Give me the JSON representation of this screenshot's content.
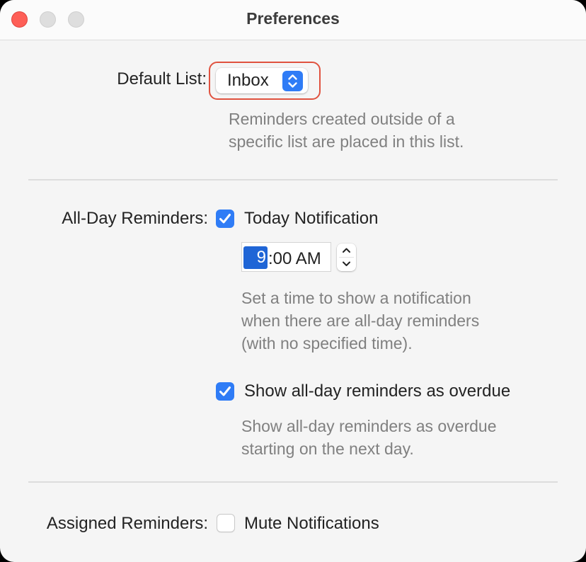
{
  "window": {
    "title": "Preferences",
    "controls": {
      "close": "close-button",
      "minimize": "minimize-button",
      "zoom": "zoom-button"
    }
  },
  "default_list": {
    "label": "Default List:",
    "selected": "Inbox",
    "description_lines": [
      "Reminders created outside of a",
      "specific list are placed in this list."
    ]
  },
  "all_day": {
    "label": "All-Day Reminders:",
    "today_notification": {
      "label": "Today Notification",
      "checked": true
    },
    "time": {
      "hour": "9",
      "rest": ":00 AM",
      "selected_segment": "hour"
    },
    "time_description_lines": [
      "Set a time to show a notification",
      "when there are all-day reminders",
      "(with no specified time)."
    ],
    "overdue": {
      "label": "Show all-day reminders as overdue",
      "checked": true
    },
    "overdue_description_lines": [
      "Show all-day reminders as overdue",
      "starting on the next day."
    ]
  },
  "assigned": {
    "label": "Assigned Reminders:",
    "mute": {
      "label": "Mute Notifications",
      "checked": false
    }
  },
  "colors": {
    "accent": "#2f7cf6",
    "focus_ring": "#e0523f",
    "close": "#fe5f57",
    "secondary_text": "#808080"
  }
}
